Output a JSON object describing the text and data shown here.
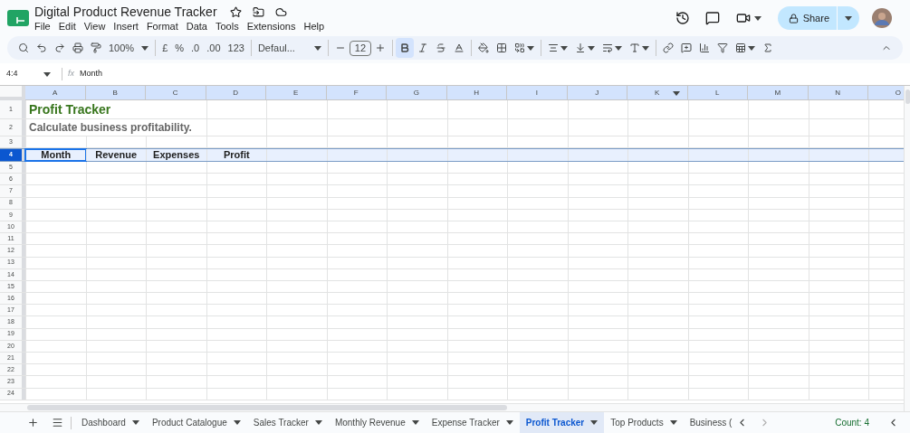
{
  "document": {
    "title": "Digital Product Revenue Tracker"
  },
  "menu": [
    "File",
    "Edit",
    "View",
    "Insert",
    "Format",
    "Data",
    "Tools",
    "Extensions",
    "Help"
  ],
  "share": {
    "label": "Share"
  },
  "toolbar": {
    "zoom": "100%",
    "currency": "£",
    "percent": "%",
    "decrease_decimal": ".0",
    "increase_decimal": ".00",
    "number_format": "123",
    "font": "Defaul...",
    "font_size": "12",
    "bold": true
  },
  "formula_bar": {
    "cell_ref": "4:4",
    "fx": "fx",
    "value": "Month"
  },
  "columns": [
    {
      "label": "A",
      "selected": true,
      "dropdown": false
    },
    {
      "label": "B",
      "selected": true,
      "dropdown": false
    },
    {
      "label": "C",
      "selected": true,
      "dropdown": false
    },
    {
      "label": "D",
      "selected": true,
      "dropdown": false
    },
    {
      "label": "E",
      "selected": true,
      "dropdown": false
    },
    {
      "label": "F",
      "selected": true,
      "dropdown": false
    },
    {
      "label": "G",
      "selected": true,
      "dropdown": false
    },
    {
      "label": "H",
      "selected": true,
      "dropdown": false
    },
    {
      "label": "I",
      "selected": true,
      "dropdown": false
    },
    {
      "label": "J",
      "selected": true,
      "dropdown": false
    },
    {
      "label": "K",
      "selected": true,
      "dropdown": true
    },
    {
      "label": "L",
      "selected": true,
      "dropdown": false
    },
    {
      "label": "M",
      "selected": true,
      "dropdown": false
    },
    {
      "label": "N",
      "selected": true,
      "dropdown": false
    },
    {
      "label": "O",
      "selected": true,
      "dropdown": false
    }
  ],
  "rows": [
    {
      "number": "1",
      "selected": false,
      "cells": [
        {
          "kind": "title",
          "text": "Profit Tracker"
        }
      ]
    },
    {
      "number": "2",
      "selected": false,
      "cells": [
        {
          "kind": "subtitle",
          "text": "Calculate business profitability."
        }
      ]
    },
    {
      "number": "3",
      "selected": false,
      "cells": []
    },
    {
      "number": "4",
      "selected": true,
      "cells": [
        {
          "kind": "header",
          "text": "Month",
          "active": true
        },
        {
          "kind": "header",
          "text": "Revenue",
          "active": false
        },
        {
          "kind": "header",
          "text": "Expenses",
          "active": false
        },
        {
          "kind": "header",
          "text": "Profit",
          "active": false
        }
      ]
    },
    {
      "number": "5",
      "selected": false,
      "cells": []
    },
    {
      "number": "6",
      "selected": false,
      "cells": []
    },
    {
      "number": "7",
      "selected": false,
      "cells": []
    },
    {
      "number": "8",
      "selected": false,
      "cells": []
    },
    {
      "number": "9",
      "selected": false,
      "cells": []
    },
    {
      "number": "10",
      "selected": false,
      "cells": []
    },
    {
      "number": "11",
      "selected": false,
      "cells": []
    },
    {
      "number": "12",
      "selected": false,
      "cells": []
    },
    {
      "number": "13",
      "selected": false,
      "cells": []
    },
    {
      "number": "14",
      "selected": false,
      "cells": []
    },
    {
      "number": "15",
      "selected": false,
      "cells": []
    },
    {
      "number": "16",
      "selected": false,
      "cells": []
    },
    {
      "number": "17",
      "selected": false,
      "cells": []
    },
    {
      "number": "18",
      "selected": false,
      "cells": []
    },
    {
      "number": "19",
      "selected": false,
      "cells": []
    },
    {
      "number": "20",
      "selected": false,
      "cells": []
    },
    {
      "number": "21",
      "selected": false,
      "cells": []
    },
    {
      "number": "22",
      "selected": false,
      "cells": []
    },
    {
      "number": "23",
      "selected": false,
      "cells": []
    },
    {
      "number": "24",
      "selected": false,
      "cells": []
    }
  ],
  "sheet_tabs": [
    {
      "label": "Dashboard",
      "selected": false
    },
    {
      "label": "Product Catalogue",
      "selected": false
    },
    {
      "label": "Sales Tracker",
      "selected": false
    },
    {
      "label": "Monthly Revenue",
      "selected": false
    },
    {
      "label": "Expense Tracker",
      "selected": false
    },
    {
      "label": "Profit Tracker",
      "selected": true
    },
    {
      "label": "Top Products",
      "selected": false
    },
    {
      "label": "Business (",
      "selected": false
    }
  ],
  "status": {
    "count": "Count: 4"
  }
}
